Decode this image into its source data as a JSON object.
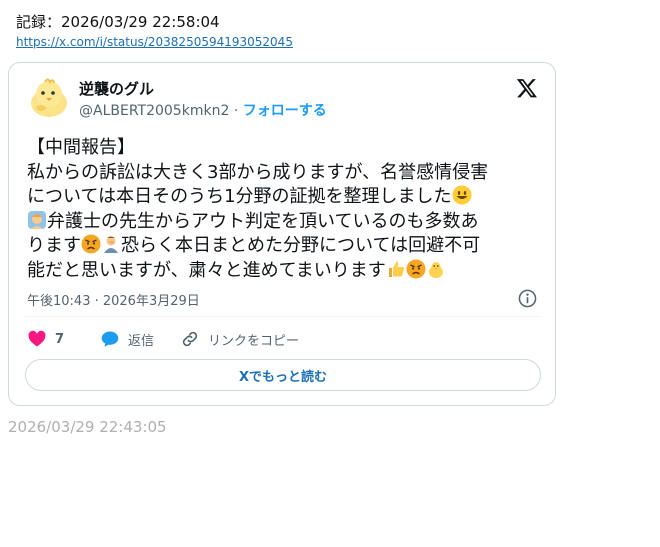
{
  "record": {
    "label": "記録：2026/03/29 22:58:04",
    "url": "https://x.com/i/status/2038250594193052045"
  },
  "tweet": {
    "author_name": "逆襲のグル",
    "handle": "@ALBERT2005kmkn2",
    "separator": "·",
    "follow_label": "フォローする",
    "lines": [
      "【中間報告】",
      "私からの訴訟は大きく3部から成りますが、名誉感情侵害",
      "については本日そのうち1分野の証拠を整理しました",
      "弁護士の先生からアウト判定を頂いているのも多数あ",
      "ります",
      "恐らく本日まとめた分野については回避不可",
      "能だと思いますが、粛々と進めてまいります"
    ],
    "timestamp": "午後10:43 · 2026年3月29日",
    "like_count": "7",
    "reply_label": "返信",
    "copy_link_label": "リンクをコピー",
    "read_more_label": "Xでもっと読む"
  },
  "icons": {
    "avatar": "chick-avatar",
    "x": "x-logo-icon",
    "info": "info-icon",
    "like": "heart-icon",
    "reply": "reply-bubble-icon",
    "link": "link-icon"
  },
  "colors": {
    "accent": "#1d9bf0",
    "like": "#f91880",
    "muted": "#536471",
    "border": "#cfd9de"
  },
  "footer": {
    "timestamp": "2026/03/29 22:43:05"
  }
}
